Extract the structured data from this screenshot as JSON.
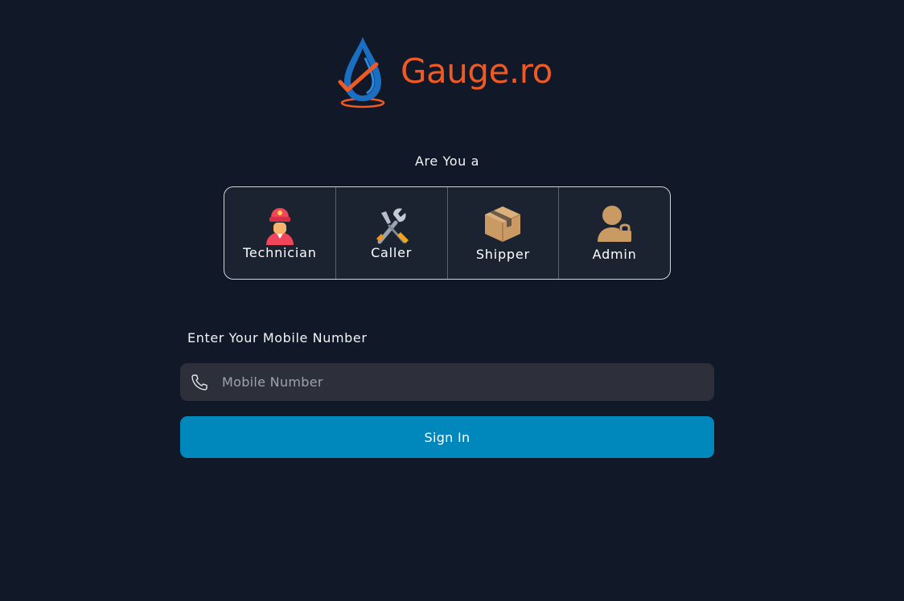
{
  "brand": {
    "name": "Gauge.ro",
    "logo_icon": "water-drop-check-logo",
    "colors": {
      "orange": "#ef5a24",
      "blue": "#1b6fc2"
    }
  },
  "role_selector": {
    "prompt": "Are You a",
    "roles": [
      {
        "label": "Technician",
        "icon": "technician-icon"
      },
      {
        "label": "Caller",
        "icon": "tools-icon"
      },
      {
        "label": "Shipper",
        "icon": "package-icon"
      },
      {
        "label": "Admin",
        "icon": "admin-lock-icon"
      }
    ]
  },
  "login": {
    "label": "Enter Your Mobile Number",
    "mobile_placeholder": "Mobile Number",
    "mobile_value": "",
    "field_icon": "phone-icon",
    "submit_label": "Sign In",
    "submit_color": "#0088bc"
  },
  "theme": {
    "background": "#111827",
    "field_background": "#2d2f3b"
  }
}
